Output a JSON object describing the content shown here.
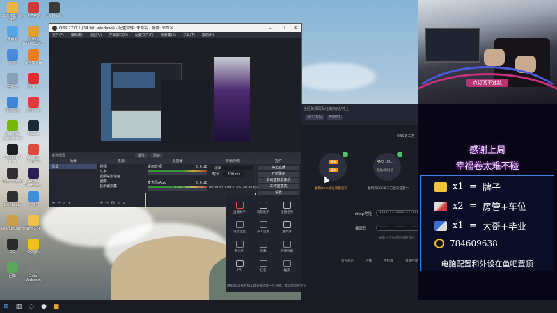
{
  "desktop": {
    "icons": [
      {
        "label": "李楠苏年分班注群",
        "color": "#e8b64a"
      },
      {
        "label": "火栏官网",
        "color": "#d33838"
      },
      {
        "label": "LX Music",
        "color": "#3b3b3b"
      },
      {
        "label": "此电脑",
        "color": "#5aa3e6"
      },
      {
        "label": "PUBG BATTLEGR...",
        "color": "#e0a030"
      },
      {
        "label": "网络",
        "color": "#4a8ad8"
      },
      {
        "label": "雷神加速器",
        "color": "#f07b1b"
      },
      {
        "label": "回收站",
        "color": "#8aa0b8"
      },
      {
        "label": "拼多多",
        "color": "#e02e2e"
      },
      {
        "label": "控制面板",
        "color": "#3f86d6"
      },
      {
        "label": "雷锦头条",
        "color": "#e23a3a"
      },
      {
        "label": "GeForce Experience",
        "color": "#76b900"
      },
      {
        "label": "Steam",
        "color": "#1b2838"
      },
      {
        "label": "Logitech G HUB",
        "color": "#1f1f1f"
      },
      {
        "label": "Google Chrome",
        "color": "#e04a3a"
      },
      {
        "label": "OBS Studio",
        "color": "#302e31"
      },
      {
        "label": "Adobe Premiere",
        "color": "#2a1c55"
      },
      {
        "label": "Bandicam",
        "color": "#2f2f2f"
      },
      {
        "label": "游戏",
        "color": "#3a8fe0"
      },
      {
        "label": "LeagueLauncher",
        "color": "#c8a04a"
      },
      {
        "label": "新建文件",
        "color": "#f0c24a"
      },
      {
        "label": "QQ",
        "color": "#2a2a2a"
      },
      {
        "label": "QQ音乐",
        "color": "#f2c21a"
      },
      {
        "label": "回车",
        "color": "#5aa65a"
      },
      {
        "label": "Elden Webcam",
        "color": "#7e7e7e"
      }
    ]
  },
  "obs": {
    "title": "OBS 27.0.1 (64 bit, windows) - 配置文件: 未命名 - 场景: 未命名",
    "menu": [
      "文件(F)",
      "编辑(E)",
      "视图(V)",
      "停靠窗口(D)",
      "配置文件(P)",
      "场景集(S)",
      "工具(T)",
      "帮助(H)"
    ],
    "no_source_label": "未选择源",
    "scene_buttons": [
      "属性",
      "滤镜"
    ],
    "docks": {
      "scenes": {
        "header": "场景",
        "items": [
          "场景"
        ]
      },
      "sources": {
        "header": "来源",
        "items": [
          "视频",
          "文字",
          "视频采集设备",
          "图像",
          "显示器采集"
        ]
      },
      "mixer": {
        "header": "混音器",
        "tracks": [
          {
            "name": "桌面音频",
            "level": "0.0 dB"
          },
          {
            "name": "麦克风/Aux",
            "level": "0.0 dB"
          }
        ]
      },
      "transitions": {
        "header": "转场特效",
        "type": "淡出",
        "duration_label": "时长",
        "duration": "300 ms"
      },
      "controls": {
        "header": "控件",
        "buttons": [
          "停止直播",
          "开始录制",
          "启动虚拟摄像机",
          "工作室模式",
          "设置",
          "退出"
        ]
      }
    },
    "status": {
      "live": "LIVE: 00:00:00",
      "rec": "REC: 00:00:00",
      "cpu": "CPU: 0.6%, 60.00 fps"
    }
  },
  "assistant": {
    "top_text": "全区免费网页/业端/哈哈/钟上",
    "stats": [
      "3821874",
      "59301"
    ],
    "obs_third": "OBS第三方",
    "step1_buttons": [
      "复制",
      "复制"
    ],
    "step1_caption": "复制rtmp地址和推流码",
    "step2_label": "RMS URL",
    "step2_sub": "粘贴/填码值",
    "step2_caption": "复制到OBS第三方推流设置中",
    "rtmp_label": "rtmp地址",
    "rtmp_value": "••••••••••••••••••••",
    "key_label": "推流码",
    "key_value": "••••••••••••••••••••",
    "hint": "未填写rtmp地址或推流码",
    "notice": "由电脑/设备直播工具开播功能一旦开播，推流地址会变化"
  },
  "tools": [
    {
      "label": "直播助手",
      "color": "#e0523a"
    },
    {
      "label": "房管助手",
      "color": "#bbb"
    },
    {
      "label": "主播任务",
      "color": "#bbb"
    },
    {
      "label": "语音连麦",
      "color": "#888"
    },
    {
      "label": "多人连麦",
      "color": "#888"
    },
    {
      "label": "道具屏",
      "color": "#bbb"
    },
    {
      "label": "粉丝团",
      "color": "#888"
    },
    {
      "label": "弹幕",
      "color": "#888"
    },
    {
      "label": "直播数据",
      "color": "#888"
    },
    {
      "label": "PK",
      "color": "#bbb"
    },
    {
      "label": "红包",
      "color": "#888"
    },
    {
      "label": "抽奖",
      "color": "#888"
    }
  ],
  "assistant_bottom": [
    "官方商店",
    "连线",
    "主打歌",
    "直播回放"
  ],
  "overlay": {
    "banner": "点订阅不迷路",
    "thanks_line1": "感谢上周",
    "thanks_line2": "幸福卷太难不碰",
    "prizes": [
      {
        "count": "x1",
        "eq": "=",
        "prize": "牌子",
        "color": "#f2c43a"
      },
      {
        "count": "x2",
        "eq": "=",
        "prize": "房管+车位",
        "color": "#d93a3a"
      },
      {
        "count": "x1",
        "eq": "=",
        "prize": "大哥+毕业",
        "color": "#3a6ed9"
      }
    ],
    "qq": "784609638",
    "footer": "电脑配置和外设在鱼吧置顶"
  },
  "taskbar": {
    "items": [
      "windows-start",
      "task-view",
      "search",
      "obs-task",
      "app-task"
    ]
  }
}
